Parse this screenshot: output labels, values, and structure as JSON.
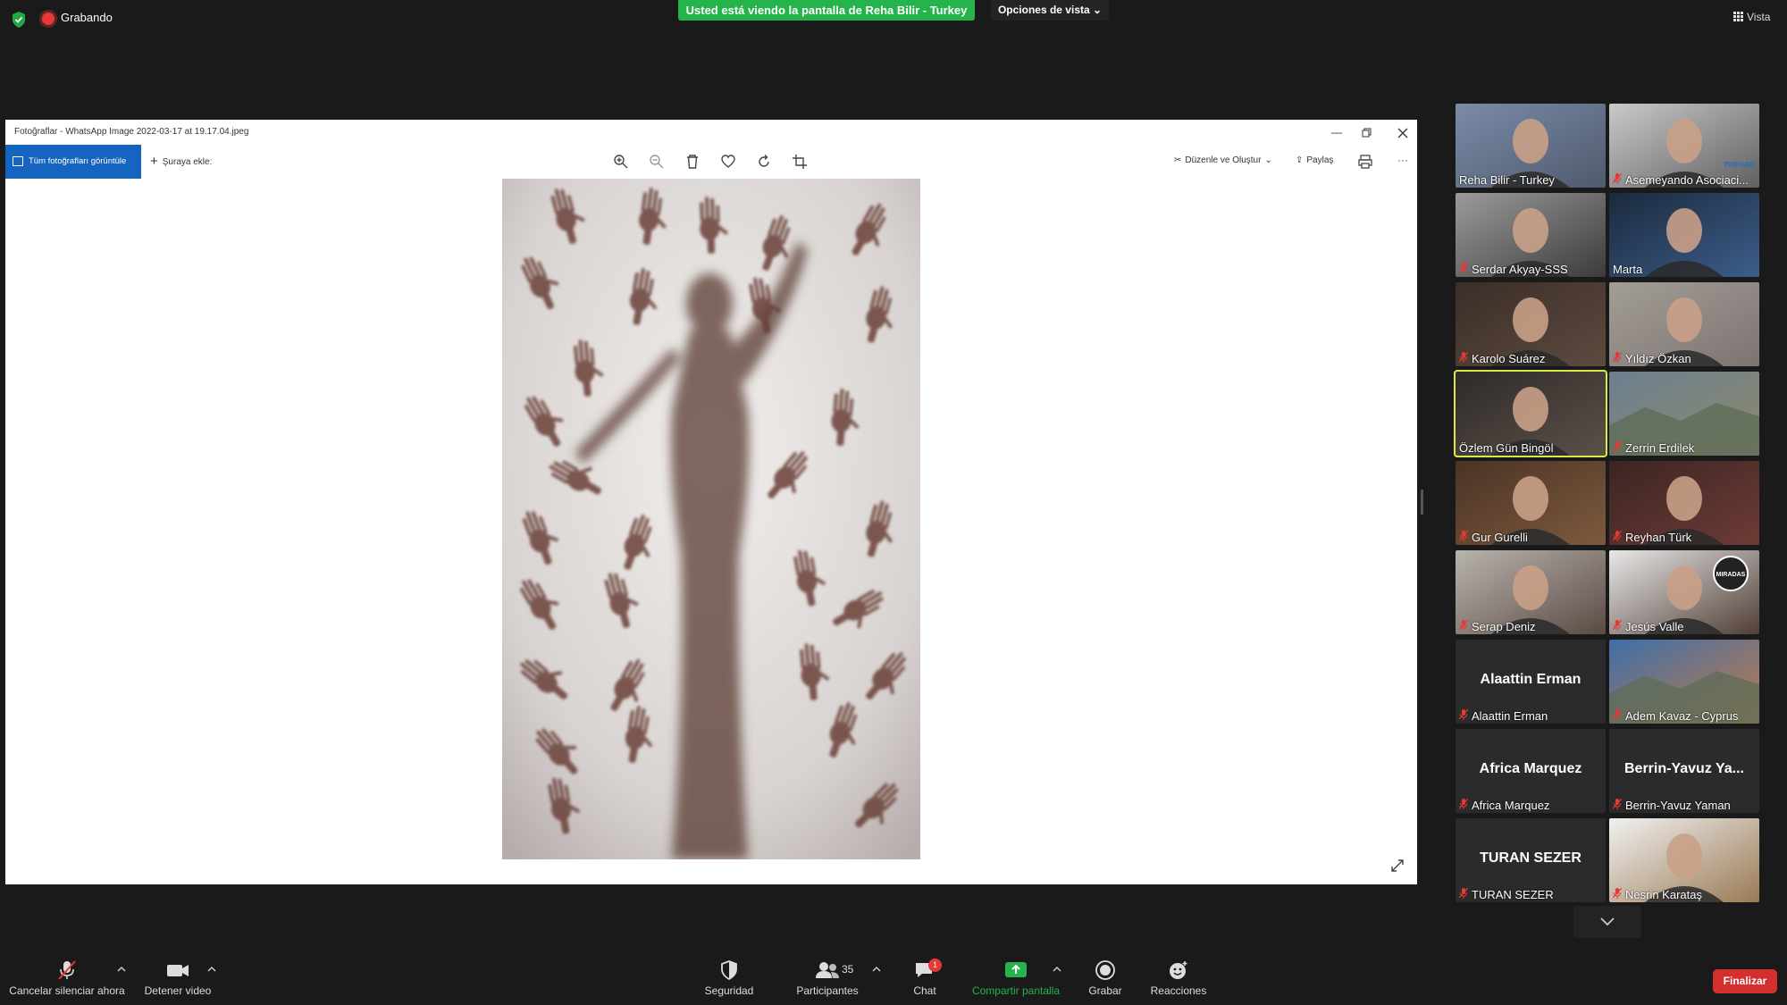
{
  "recording": {
    "label": "Grabando"
  },
  "share_banner": "Usted está viendo la pantalla de Reha Bilir - Turkey",
  "view_options": "Opciones de vista ⌄",
  "view_label": "Vista",
  "window": {
    "title": "Fotoğraflar - WhatsApp Image 2022-03-17 at 19.17.04.jpeg",
    "all_photos": "Tüm fotoğrafları görüntüle",
    "add_to": "Şuraya ekle:",
    "edit_create": "Düzenle ve Oluştur",
    "share": "Paylaş",
    "more": "···"
  },
  "participants": [
    {
      "name": "Reha Bilir - Turkey",
      "muted": false
    },
    {
      "name": "Asemeyando Asociaci...",
      "muted": true
    },
    {
      "name": "Serdar Akyay-SSS",
      "muted": true
    },
    {
      "name": "Marta",
      "muted": false
    },
    {
      "name": "Karolo Suárez",
      "muted": true
    },
    {
      "name": "Yıldız Özkan",
      "muted": true
    },
    {
      "name": "Özlem Gün Bingöl",
      "muted": false
    },
    {
      "name": "Zerrin Erdilek",
      "muted": true
    },
    {
      "name": "Gur Gurelli",
      "muted": true
    },
    {
      "name": "Reyhan Türk",
      "muted": true
    },
    {
      "name": "Serap Deniz",
      "muted": true
    },
    {
      "name": "Jesús Valle",
      "muted": true
    },
    {
      "name": "Alaattin Erman",
      "muted": true,
      "display": "Alaattin Erman"
    },
    {
      "name": "Adem Kavaz - Cyprus",
      "muted": true
    },
    {
      "name": "Africa Marquez",
      "muted": true,
      "display": "Africa Marquez"
    },
    {
      "name": "Berrin-Yavuz Yaman",
      "muted": true,
      "display": "Berrin-Yavuz Ya..."
    },
    {
      "name": "TURAN SEZER",
      "muted": true,
      "display": "TURAN SEZER"
    },
    {
      "name": "Nesrin Karataş",
      "muted": true
    }
  ],
  "tile_logo": "meuan",
  "tile_badge": "MIRADAS",
  "toolbar": {
    "mute": "Cancelar silenciar ahora",
    "video": "Detener video",
    "security": "Seguridad",
    "participants": "Participantes",
    "participants_count": "35",
    "chat": "Chat",
    "chat_badge": "1",
    "share_screen": "Compartir pantalla",
    "record": "Grabar",
    "reactions": "Reacciones",
    "end": "Finalizar"
  },
  "colors": {
    "share_green": "#25b34b",
    "end_red": "#d32f2f",
    "active_speaker": "#d9e84b",
    "photos_blue": "#1565c0"
  }
}
